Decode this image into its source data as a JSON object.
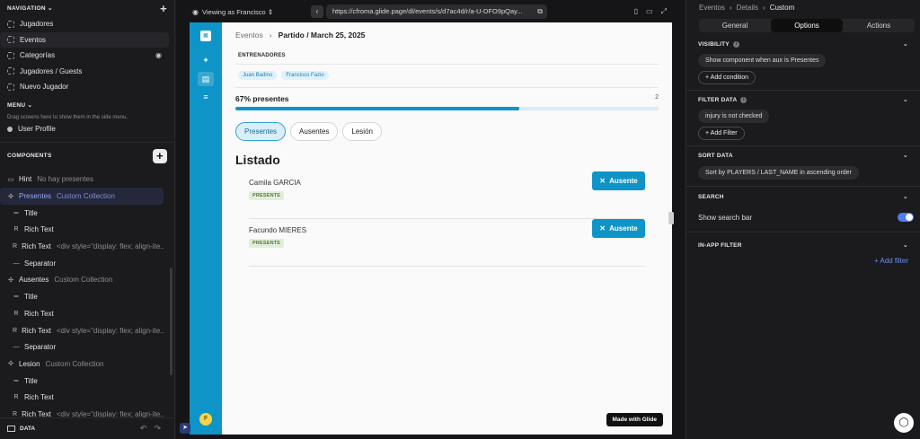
{
  "left": {
    "navigation_label": "NAVIGATION",
    "nav_items": [
      {
        "label": "Jugadores"
      },
      {
        "label": "Eventos"
      },
      {
        "label": "Categorías"
      },
      {
        "label": "Jugadores / Guests"
      },
      {
        "label": "Nuevo Jugador"
      }
    ],
    "menu_label": "MENU",
    "menu_hint": "Drag screens here to show them in the side menu.",
    "user_profile": "User Profile",
    "components_label": "COMPONENTS",
    "components": [
      {
        "label": "Hint",
        "secondary": "No hay presentes",
        "glyph": "▭",
        "sub": false
      },
      {
        "label": "Presentes",
        "secondary": "Custom Collection",
        "glyph": "✣",
        "sub": false
      },
      {
        "label": "Title",
        "secondary": "",
        "glyph": "═",
        "sub": true
      },
      {
        "label": "Rich Text",
        "secondary": "",
        "glyph": "R",
        "sub": true
      },
      {
        "label": "Rich Text",
        "secondary": "<div style=\"display: flex; align-ite...",
        "glyph": "R",
        "sub": true
      },
      {
        "label": "Separator",
        "secondary": "",
        "glyph": "—",
        "sub": true
      },
      {
        "label": "Ausentes",
        "secondary": "Custom Collection",
        "glyph": "✣",
        "sub": false
      },
      {
        "label": "Title",
        "secondary": "",
        "glyph": "═",
        "sub": true
      },
      {
        "label": "Rich Text",
        "secondary": "",
        "glyph": "R",
        "sub": true
      },
      {
        "label": "Rich Text",
        "secondary": "<div style=\"display: flex; align-ite...",
        "glyph": "R",
        "sub": true
      },
      {
        "label": "Separator",
        "secondary": "",
        "glyph": "—",
        "sub": true
      },
      {
        "label": "Lesion",
        "secondary": "Custom Collection",
        "glyph": "✣",
        "sub": false
      },
      {
        "label": "Title",
        "secondary": "",
        "glyph": "═",
        "sub": true
      },
      {
        "label": "Rich Text",
        "secondary": "",
        "glyph": "R",
        "sub": true
      },
      {
        "label": "Rich Text",
        "secondary": "<div style=\"display: flex; align-ite...",
        "glyph": "R",
        "sub": true
      }
    ],
    "data_label": "DATA"
  },
  "topbar": {
    "viewing_as": "Viewing as Francisco",
    "url": "https://cfroma.glide.page/dl/events/s/d7ac4d/r/a-U-DFO9pQay..."
  },
  "app": {
    "breadcrumb_parent": "Eventos",
    "breadcrumb_current": "Partido / March 25, 2025",
    "coaches_label": "ENTRENADORES",
    "coaches": [
      "Juan Badino",
      "Francisco Fazio"
    ],
    "progress_label": "67% presentes",
    "progress_count": "2",
    "progress_fraction": 0.67,
    "tabs": [
      "Presentes",
      "Ausentes",
      "Lesión"
    ],
    "list_title": "Listado",
    "rows": [
      {
        "name": "Camila GARCIA",
        "badge": "PRESENTE",
        "button": "Ausente"
      },
      {
        "name": "Facundo MIERES",
        "badge": "PRESENTE",
        "button": "Ausente"
      }
    ],
    "made_with": "Made with Glide",
    "avatar_initial": "F"
  },
  "right": {
    "breadcrumb": [
      "Eventos",
      "Details",
      "Custom"
    ],
    "tabs": [
      "General",
      "Options",
      "Actions"
    ],
    "visibility_label": "VISIBILITY",
    "visibility_rule": "Show component when aux is Presentes",
    "add_condition": "Add condition",
    "filter_label": "FILTER DATA",
    "filter_rule": "injury is not checked",
    "add_filter_btn": "Add Filter",
    "sort_label": "SORT DATA",
    "sort_rule": "Sort by PLAYERS / LAST_NAME in ascending order",
    "search_label": "SEARCH",
    "show_search": "Show search bar",
    "inapp_label": "IN-APP FILTER",
    "add_filter_link": "Add filter"
  },
  "colors": {
    "accent": "#0f94c7",
    "link": "#6d8df5",
    "toggle": "#4e7cf5"
  }
}
